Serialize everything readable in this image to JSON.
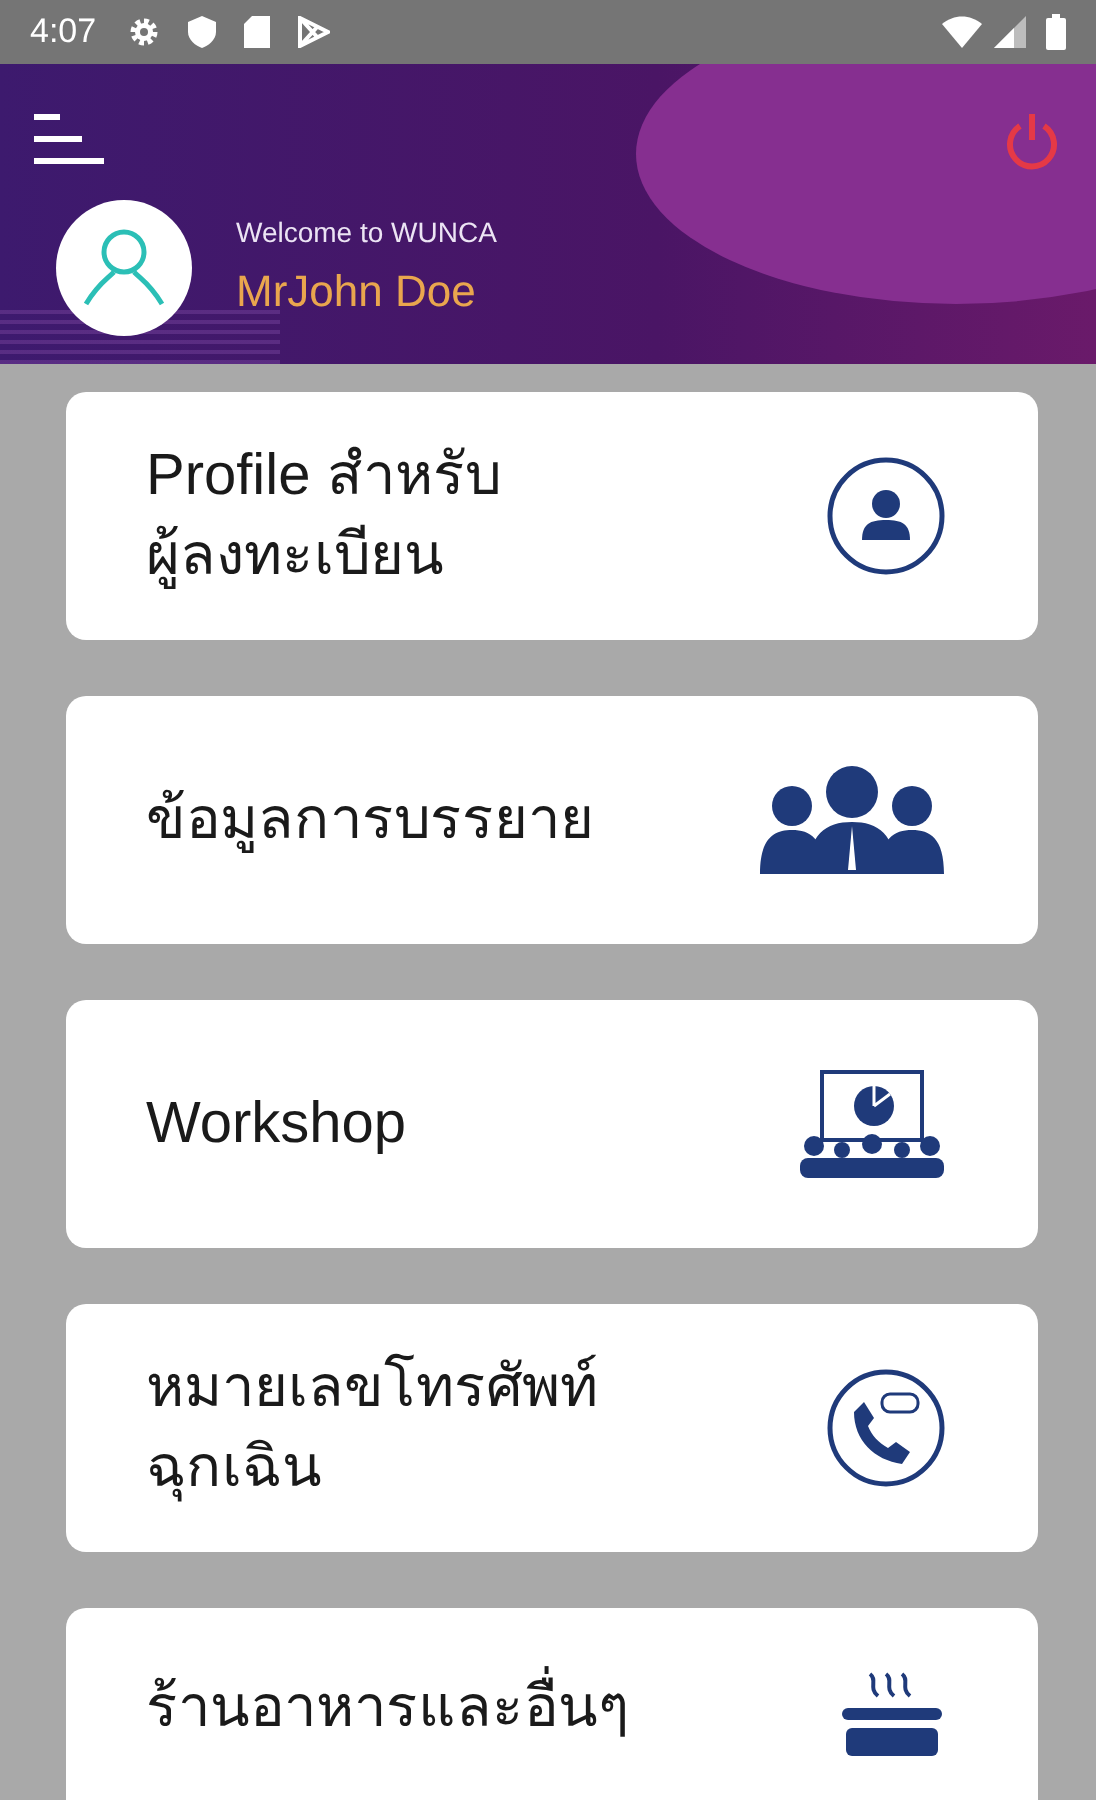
{
  "status_bar": {
    "time": "4:07"
  },
  "header": {
    "welcome": "Welcome to WUNCA",
    "user_name": "MrJohn Doe"
  },
  "menu_items": [
    {
      "label": "Profile สำหรับ\nผู้ลงทะเบียน"
    },
    {
      "label": "ข้อมูลการบรรยาย"
    },
    {
      "label": "Workshop"
    },
    {
      "label": "หมายเลขโทรศัพท์\nฉุกเฉิน"
    },
    {
      "label": "ร้านอาหารและอื่นๆ"
    }
  ]
}
